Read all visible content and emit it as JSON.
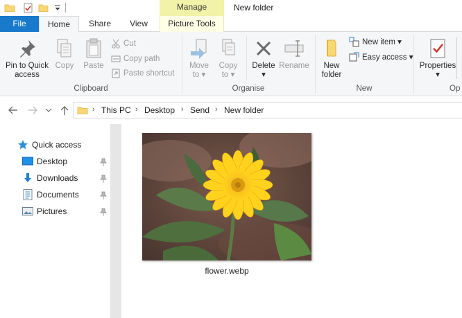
{
  "window": {
    "title": "New folder",
    "context_tab": "Manage",
    "colors": {
      "file_tab": "#1979ca",
      "manage_tab": "#f2f2a8",
      "ribbon_bg": "#f5f6f7",
      "accent_blue": "#1979ca"
    }
  },
  "tabs": {
    "file": "File",
    "home": "Home",
    "share": "Share",
    "view": "View",
    "picture_tools": "Picture Tools"
  },
  "ribbon": {
    "clipboard": {
      "label": "Clipboard",
      "pin_line1": "Pin to Quick",
      "pin_line2": "access",
      "copy": "Copy",
      "paste": "Paste",
      "cut": "Cut",
      "copy_path": "Copy path",
      "paste_shortcut": "Paste shortcut"
    },
    "organise": {
      "label": "Organise",
      "move_to_line1": "Move",
      "move_to_line2": "to",
      "copy_to_line1": "Copy",
      "copy_to_line2": "to",
      "delete": "Delete",
      "rename": "Rename"
    },
    "new": {
      "label": "New",
      "new_folder_line1": "New",
      "new_folder_line2": "folder",
      "new_item": "New item",
      "easy_access": "Easy access"
    },
    "open": {
      "label": "Op",
      "properties": "Properties"
    }
  },
  "address": {
    "crumbs": [
      "This PC",
      "Desktop",
      "Send",
      "New folder"
    ]
  },
  "nav_pane": {
    "quick_access": "Quick access",
    "items": [
      {
        "label": "Desktop",
        "icon": "desktop-icon",
        "pinned": true
      },
      {
        "label": "Downloads",
        "icon": "downloads-icon",
        "pinned": true
      },
      {
        "label": "Documents",
        "icon": "documents-icon",
        "pinned": true
      },
      {
        "label": "Pictures",
        "icon": "pictures-icon",
        "pinned": true
      }
    ]
  },
  "files": [
    {
      "name": "flower.webp",
      "type": "image"
    }
  ]
}
